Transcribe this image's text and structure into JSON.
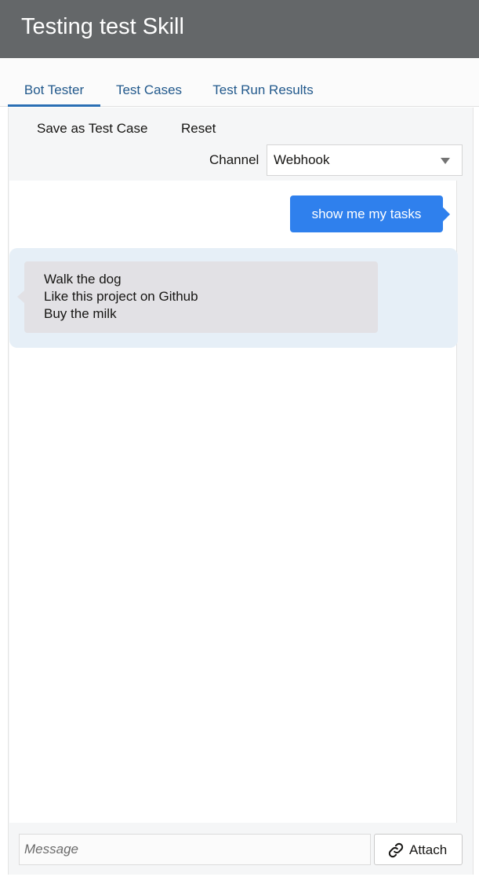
{
  "header": {
    "title": "Testing test Skill"
  },
  "tabs": [
    {
      "label": "Bot Tester",
      "active": true
    },
    {
      "label": "Test Cases",
      "active": false
    },
    {
      "label": "Test Run Results",
      "active": false
    }
  ],
  "toolbar": {
    "save_label": "Save as Test Case",
    "reset_label": "Reset"
  },
  "channel": {
    "label": "Channel",
    "selected": "Webhook"
  },
  "conversation": {
    "user_message": "show me my tasks",
    "bot_lines": [
      "Walk the dog",
      "Like this project on Github",
      "Buy the milk"
    ]
  },
  "composer": {
    "placeholder": "Message",
    "value": "",
    "attach_label": "Attach"
  },
  "colors": {
    "header_bg": "#646769",
    "accent": "#2f80ed",
    "tab_text": "#22598c",
    "bot_row_bg": "#e6eff7",
    "bot_bubble_bg": "#e2e1e5"
  },
  "icons": {
    "attach": "link-icon",
    "dropdown": "chevron-down-icon"
  }
}
